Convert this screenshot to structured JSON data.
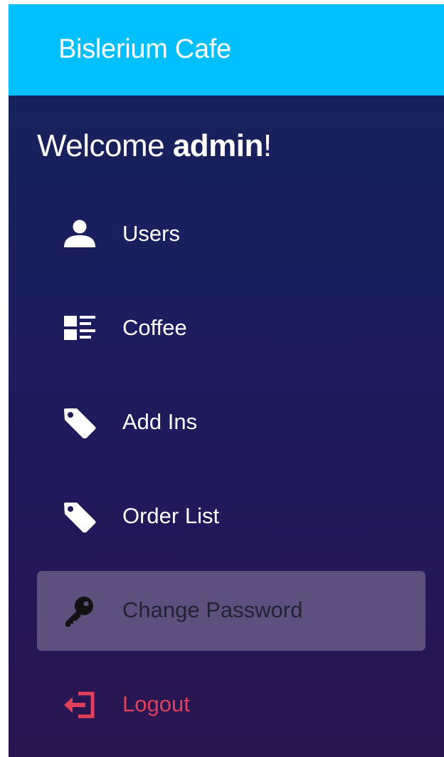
{
  "header": {
    "brand": "Bislerium Cafe"
  },
  "sidebar": {
    "welcome_prefix": "Welcome ",
    "welcome_user": "admin",
    "welcome_suffix": "!",
    "items": [
      {
        "label": "Users",
        "icon": "user-icon",
        "active": false
      },
      {
        "label": "Coffee",
        "icon": "list-icon",
        "active": false
      },
      {
        "label": "Add Ins",
        "icon": "tag-icon",
        "active": false
      },
      {
        "label": "Order List",
        "icon": "tag-icon",
        "active": false
      },
      {
        "label": "Change Password",
        "icon": "key-icon",
        "active": true
      },
      {
        "label": "Logout",
        "icon": "logout-icon",
        "active": false
      }
    ]
  },
  "colors": {
    "header_bg": "#00bfff",
    "sidebar_top": "#17225c",
    "sidebar_bottom": "#2a1550",
    "active_item_bg": "#5d4f7e",
    "logout": "#e23f5a",
    "text": "#ffffff"
  }
}
